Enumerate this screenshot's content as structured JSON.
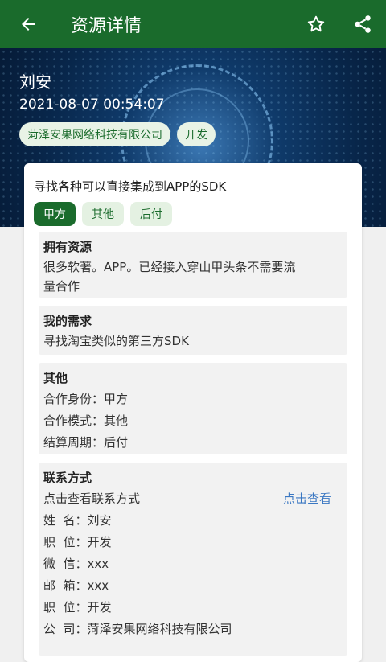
{
  "appbar": {
    "title": "资源详情",
    "back_icon": "arrow-left-icon",
    "star_icon": "star-outline-icon",
    "share_icon": "share-icon"
  },
  "colors": {
    "primary": "#1a6b2c",
    "link": "#3a77c2"
  },
  "banner": {
    "name": "刘安",
    "time": "2021-08-07 00:54:07",
    "tags": [
      "菏泽安果网络科技有限公司",
      "开发"
    ]
  },
  "card": {
    "headline": "寻找各种可以直接集成到APP的SDK",
    "chips": [
      "甲方",
      "其他",
      "后付"
    ],
    "resources": {
      "heading": "拥有资源",
      "line1": "很多软著。APP。已经接入穿山甲头条不需要流",
      "line2": "量合作"
    },
    "needs": {
      "heading": "我的需求",
      "text": "寻找淘宝类似的第三方SDK"
    },
    "other": {
      "heading": "其他",
      "rows": [
        "合作身份：甲方",
        "合作模式：其他",
        "结算周期：后付"
      ]
    },
    "contact": {
      "heading": "联系方式",
      "prompt": "点击查看联系方式",
      "view_link": "点击查看",
      "rows": [
        "姓  名：刘安",
        "职  位：开发",
        "微  信：xxx",
        "邮  箱：xxx",
        "职  位：开发",
        "公  司：菏泽安果网络科技有限公司"
      ]
    }
  }
}
